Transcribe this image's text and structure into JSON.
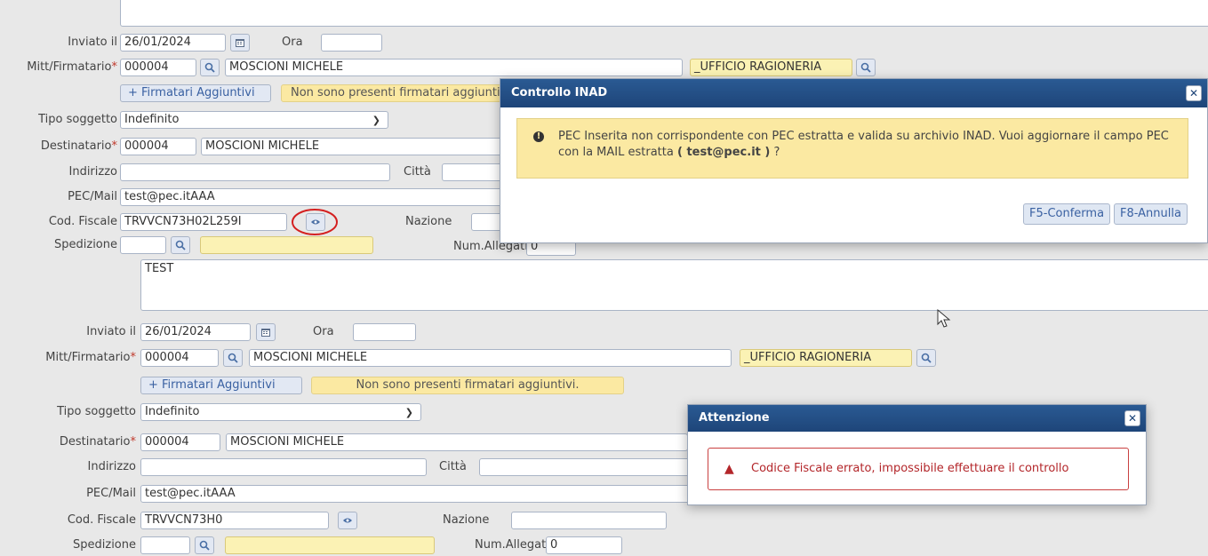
{
  "form1": {
    "inviato_label": "Inviato il",
    "inviato_value": "26/01/2024",
    "ora_label": "Ora",
    "ora_value": "",
    "mitt_label": "Mitt/Firmatario",
    "mitt_code": "000004",
    "mitt_name": "MOSCIONI MICHELE",
    "mitt_office": "_UFFICIO RAGIONERIA",
    "firmatari_btn": "+ Firmatari Aggiuntivi",
    "firmatari_note": "Non sono presenti firmatari aggiuntivi.",
    "tipo_label": "Tipo soggetto",
    "tipo_value": "Indefinito",
    "dest_label": "Destinatario",
    "dest_code": "000004",
    "dest_name": "MOSCIONI MICHELE",
    "indirizzo_label": "Indirizzo",
    "indirizzo_value": "",
    "citta_label": "Città",
    "citta_value": "",
    "pec_label": "PEC/Mail",
    "pec_value": "test@pec.itAAA",
    "cf_label": "Cod. Fiscale",
    "cf_value": "TRVVCN73H02L259I",
    "nazione_label": "Nazione",
    "nazione_value": "",
    "sped_label": "Spedizione",
    "sped_code": "",
    "sped_desc": "",
    "allegati_label": "Num.Allegati",
    "allegati_value": "0",
    "note_text": "TEST"
  },
  "form2": {
    "inviato_label": "Inviato il",
    "inviato_value": "26/01/2024",
    "ora_label": "Ora",
    "ora_value": "",
    "mitt_label": "Mitt/Firmatario",
    "mitt_code": "000004",
    "mitt_name": "MOSCIONI MICHELE",
    "mitt_office": "_UFFICIO RAGIONERIA",
    "firmatari_btn": "+ Firmatari Aggiuntivi",
    "firmatari_note": "Non sono presenti firmatari aggiuntivi.",
    "tipo_label": "Tipo soggetto",
    "tipo_value": "Indefinito",
    "dest_label": "Destinatario",
    "dest_code": "000004",
    "dest_name": "MOSCIONI MICHELE",
    "indirizzo_label": "Indirizzo",
    "indirizzo_value": "",
    "citta_label": "Città",
    "citta_value": "",
    "pec_label": "PEC/Mail",
    "pec_value": "test@pec.itAAA",
    "cf_label": "Cod. Fiscale",
    "cf_value": "TRVVCN73H0",
    "nazione_label": "Nazione",
    "nazione_value": "",
    "sped_label": "Spedizione",
    "sped_code": "",
    "sped_desc": "",
    "allegati_label": "Num.Allegati",
    "allegati_value": "0"
  },
  "dialog_inad": {
    "title": "Controllo INAD",
    "message_part1": "PEC Inserita non corrispondente con PEC estratta e valida su archivio INAD. Vuoi aggiornare il campo PEC con la MAIL estratta",
    "message_email": "( test@pec.it )",
    "message_end": " ?",
    "confirm_label": "F5-Conferma",
    "cancel_label": "F8-Annulla"
  },
  "dialog_attenzione": {
    "title": "Attenzione",
    "message": "Codice Fiscale errato, impossibile effettuare il controllo"
  },
  "colors": {
    "dialog_header": "#1e4579",
    "warning_bg": "#fbe9a2",
    "error_border": "#c94040",
    "required": "#c0392b"
  }
}
